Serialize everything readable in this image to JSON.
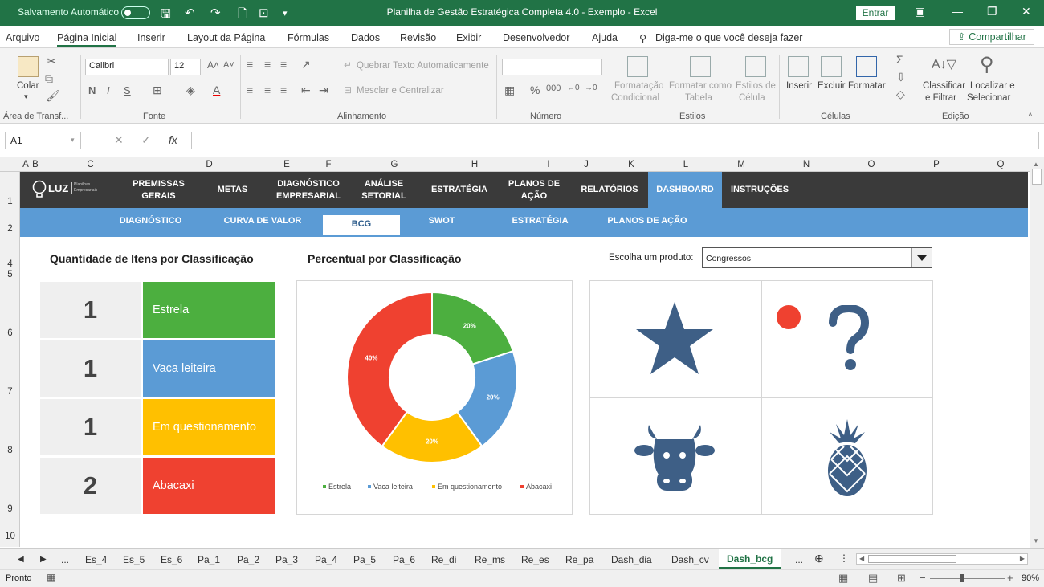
{
  "titlebar": {
    "autosave": "Salvamento Automático",
    "title": "Planilha de Gestão Estratégica Completa 4.0 - Exemplo  -  Excel",
    "login": "Entrar"
  },
  "menu": {
    "items": [
      "Arquivo",
      "Página Inicial",
      "Inserir",
      "Layout da Página",
      "Fórmulas",
      "Dados",
      "Revisão",
      "Exibir",
      "Desenvolvedor",
      "Ajuda"
    ],
    "search": "Diga-me o que você deseja fazer",
    "share": "Compartilhar"
  },
  "ribbon": {
    "paste": "Colar",
    "clipboard": "Área de Transf...",
    "font_name": "Calibri",
    "font_size": "12",
    "font_group": "Fonte",
    "wrap": "Quebrar Texto Automaticamente",
    "merge": "Mesclar e Centralizar",
    "align_group": "Alinhamento",
    "number_group": "Número",
    "cond_format_1": "Formatação",
    "cond_format_2": "Condicional",
    "format_table_1": "Formatar como",
    "format_table_2": "Tabela",
    "cell_styles_1": "Estilos de",
    "cell_styles_2": "Célula",
    "styles_group": "Estilos",
    "insert": "Inserir",
    "delete": "Excluir",
    "format": "Formatar",
    "cells_group": "Células",
    "sort_1": "Classificar",
    "sort_2": "e Filtrar",
    "find_1": "Localizar e",
    "find_2": "Selecionar",
    "edit_group": "Edição"
  },
  "formula": {
    "namebox": "A1",
    "fx": "fx"
  },
  "columns": [
    "A",
    "B",
    "C",
    "D",
    "E",
    "F",
    "G",
    "H",
    "I",
    "J",
    "K",
    "L",
    "M",
    "N",
    "O",
    "P",
    "Q"
  ],
  "rows": [
    "1",
    "2",
    "4",
    "5",
    "6",
    "7",
    "8",
    "9",
    "10"
  ],
  "logo": {
    "name": "LUZ",
    "sub1": "Planilhas",
    "sub2": "Empresariais"
  },
  "nav": {
    "items": [
      {
        "l1": "PREMISSAS",
        "l2": "GERAIS"
      },
      {
        "l1": "METAS",
        "l2": ""
      },
      {
        "l1": "DIAGNÓSTICO",
        "l2": "EMPRESARIAL"
      },
      {
        "l1": "ANÁLISE",
        "l2": "SETORIAL"
      },
      {
        "l1": "ESTRATÉGIA",
        "l2": ""
      },
      {
        "l1": "PLANOS DE",
        "l2": "AÇÃO"
      },
      {
        "l1": "RELATÓRIOS",
        "l2": ""
      },
      {
        "l1": "DASHBOARD",
        "l2": ""
      },
      {
        "l1": "INSTRUÇÕES",
        "l2": ""
      }
    ]
  },
  "subnav": [
    "DIAGNÓSTICO",
    "CURVA DE VALOR",
    "BCG",
    "SWOT",
    "ESTRATÉGIA",
    "PLANOS DE AÇÃO"
  ],
  "dashboard": {
    "qty_title": "Quantidade de Itens por Classificação",
    "pct_title": "Percentual por Classificação",
    "choose_label": "Escolha um produto:",
    "product": "Congressos",
    "counts": [
      {
        "count": "1",
        "label": "Estrela",
        "color": "#4caf3f"
      },
      {
        "count": "1",
        "label": "Vaca leiteira",
        "color": "#5b9bd5"
      },
      {
        "count": "1",
        "label": "Em questionamento",
        "color": "#ffc000"
      },
      {
        "count": "2",
        "label": "Abacaxi",
        "color": "#ef4130"
      }
    ]
  },
  "chart_data": {
    "type": "pie",
    "categories": [
      "Estrela",
      "Vaca leiteira",
      "Em questionamento",
      "Abacaxi"
    ],
    "values": [
      20,
      20,
      20,
      40
    ],
    "labels": [
      "20%",
      "20%",
      "20%",
      "40%"
    ],
    "colors": [
      "#4caf3f",
      "#5b9bd5",
      "#ffc000",
      "#ef4130"
    ],
    "title": "",
    "legend": "bottom"
  },
  "matrix_icons": [
    "star-icon",
    "question-mark-icon",
    "cow-icon",
    "pineapple-icon"
  ],
  "matrix_color": "#3e5f86",
  "sheets": [
    "Es_4",
    "Es_5",
    "Es_6",
    "Pa_1",
    "Pa_2",
    "Pa_3",
    "Pa_4",
    "Pa_5",
    "Pa_6",
    "Re_di",
    "Re_ms",
    "Re_es",
    "Re_pa",
    "Dash_dia",
    "Dash_cv",
    "Dash_bcg",
    "..."
  ],
  "status": {
    "ready": "Pronto",
    "zoom": "90%"
  }
}
